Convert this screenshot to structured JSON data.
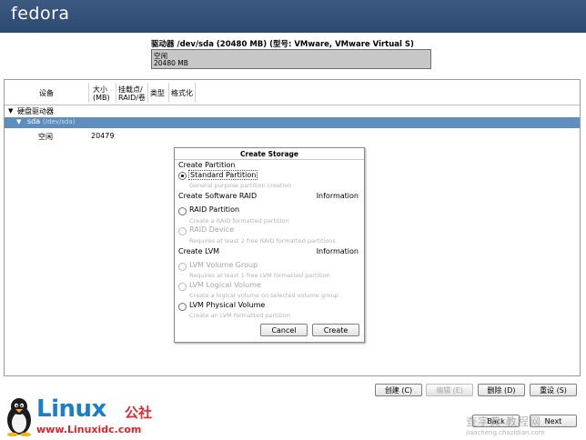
{
  "brand": {
    "os_logo": "fedora",
    "site_cn": "公社",
    "site_name": "Linux",
    "site_url": "www.Linuxidc.com"
  },
  "disk": {
    "title": "驱动器 /dev/sda (20480 MB) (型号: VMware, VMware Virtual S)",
    "bar_label": "空闲",
    "bar_size": "20480 MB"
  },
  "table": {
    "columns": [
      "设备",
      "大小\n(MB)",
      "挂载点/\nRAID/卷",
      "类型",
      "格式化"
    ],
    "rows": {
      "group_label": "硬盘驱动器",
      "disk_name": "sda",
      "disk_path": "(/dev/sda)",
      "free_label": "空闲",
      "free_size": "20479"
    }
  },
  "dialog": {
    "title": "Create Storage",
    "section_partition": "Create Partition",
    "standard_partition": "Standard Partition",
    "standard_partition_desc": "General purpose partition creation",
    "section_raid": "Create Software RAID",
    "raid_info": "Information",
    "raid_partition": "RAID Partition",
    "raid_partition_desc": "Create a RAID formatted partition",
    "raid_device": "RAID Device",
    "raid_device_desc": "Requires at least 2 free RAID formatted partitions",
    "section_lvm": "Create LVM",
    "lvm_info": "Information",
    "lvm_group": "LVM Volume Group",
    "lvm_group_desc": "Requires at least 1 free LVM formatted partition",
    "lvm_logical": "LVM Logical Volume",
    "lvm_logical_desc": "Create a logical volume on selected volume group",
    "lvm_physical": "LVM Physical Volume",
    "lvm_physical_desc": "Create an LVM formatted partition",
    "cancel_label": "Cancel",
    "create_label": "Create",
    "selected_option": "Standard Partition"
  },
  "actions": {
    "create": "创建 (C)",
    "edit": "编辑 (E)",
    "delete": "删除 (D)",
    "reset": "重设 (S)",
    "back": "Back",
    "next": "Next"
  },
  "watermark": {
    "text": "查字典 教程网",
    "url": "jiaocheng.chazidian.com"
  },
  "colors": {
    "header_band": "#2f4f78",
    "selected_row": "#5e8ebf",
    "disk_bar": "#c7c7c7",
    "brand_blue": "#1a7ec8",
    "brand_red": "#e8262b"
  }
}
